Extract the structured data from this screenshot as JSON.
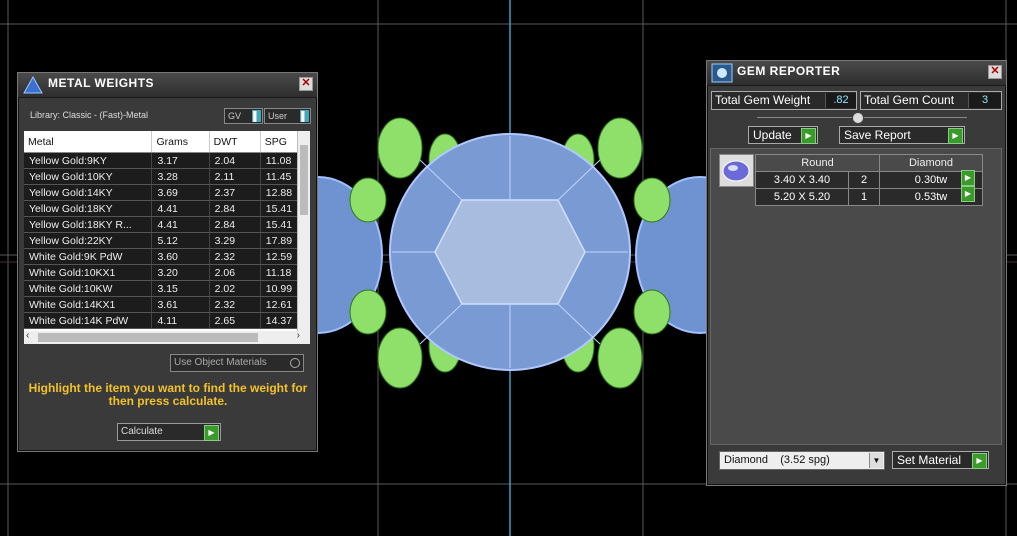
{
  "metal_weights": {
    "title": "METAL WEIGHTS",
    "library_label": "Library: Classic - (Fast)-Metal",
    "gv_label": "GV",
    "user_label": "User",
    "columns": [
      "Metal",
      "Grams",
      "DWT",
      "SPG"
    ],
    "rows": [
      [
        "Yellow Gold:9KY",
        "3.17",
        "2.04",
        "11.08"
      ],
      [
        "Yellow Gold:10KY",
        "3.28",
        "2.11",
        "11.45"
      ],
      [
        "Yellow Gold:14KY",
        "3.69",
        "2.37",
        "12.88"
      ],
      [
        "Yellow Gold:18KY",
        "4.41",
        "2.84",
        "15.41"
      ],
      [
        "Yellow Gold:18KY R...",
        "4.41",
        "2.84",
        "15.41"
      ],
      [
        "Yellow Gold:22KY",
        "5.12",
        "3.29",
        "17.89"
      ],
      [
        "White Gold:9K PdW",
        "3.60",
        "2.32",
        "12.59"
      ],
      [
        "White Gold:10KX1",
        "3.20",
        "2.06",
        "11.18"
      ],
      [
        "White Gold:10KW",
        "3.15",
        "2.02",
        "10.99"
      ],
      [
        "White Gold:14KX1",
        "3.61",
        "2.32",
        "12.61"
      ],
      [
        "White Gold:14K PdW",
        "4.11",
        "2.65",
        "14.37"
      ]
    ],
    "use_object_materials": "Use Object Materials",
    "hint": "Highlight the item you want to find the weight for then press calculate.",
    "calculate_label": "Calculate"
  },
  "gem_reporter": {
    "title": "GEM REPORTER",
    "total_weight_label": "Total Gem Weight",
    "total_weight_value": ".82",
    "total_count_label": "Total Gem Count",
    "total_count_value": "3",
    "update_label": "Update",
    "save_report_label": "Save Report",
    "table_headers": [
      "Round",
      "Diamond"
    ],
    "gems": [
      {
        "size": "3.40 X 3.40",
        "count": "2",
        "weight": "0.30tw"
      },
      {
        "size": "5.20 X 5.20",
        "count": "1",
        "weight": "0.53tw"
      }
    ],
    "material_selected": "Diamond    (3.52 spg)",
    "set_material_label": "Set Material"
  }
}
